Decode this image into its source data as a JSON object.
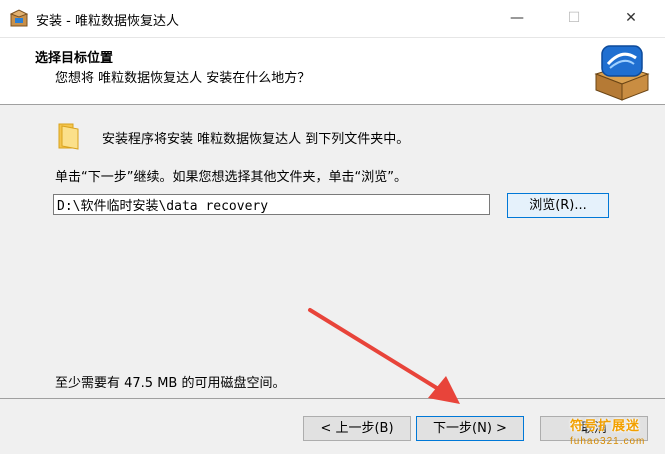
{
  "window": {
    "title": "安装 - 唯粒数据恢复达人",
    "min_glyph": "—",
    "max_glyph": "☐",
    "close_glyph": "✕"
  },
  "header": {
    "title": "选择目标位置",
    "subtitle": "您想将 唯粒数据恢复达人 安装在什么地方？"
  },
  "content": {
    "intro": "安装程序将安装 唯粒数据恢复达人 到下列文件夹中。",
    "instruction": "单击“下一步”继续。如果您想选择其他文件夹，单击“浏览”。",
    "path_value": "D:\\软件临时安装\\data recovery",
    "browse_label": "浏览(R)...",
    "space_required": "至少需要有 47.5 MB 的可用磁盘空间。"
  },
  "footer": {
    "back_label": "< 上一步(B)",
    "next_label": "下一步(N) >",
    "cancel_label": "取消"
  },
  "watermark": {
    "text": "符号扩展迷",
    "url": "fuhao321.com"
  },
  "colors": {
    "accent": "#0078d7",
    "arrow": "#e8443a",
    "folder": "#f4c54e"
  }
}
